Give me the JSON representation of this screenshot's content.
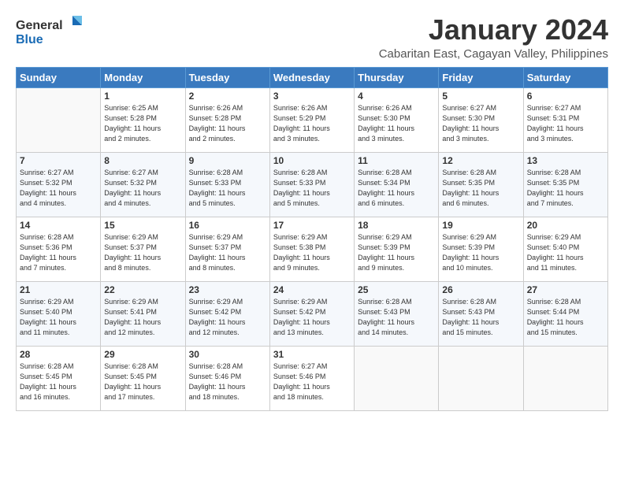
{
  "logo": {
    "general": "General",
    "blue": "Blue"
  },
  "title": {
    "month": "January 2024",
    "location": "Cabaritan East, Cagayan Valley, Philippines"
  },
  "weekdays": [
    "Sunday",
    "Monday",
    "Tuesday",
    "Wednesday",
    "Thursday",
    "Friday",
    "Saturday"
  ],
  "weeks": [
    [
      {
        "day": "",
        "info": ""
      },
      {
        "day": "1",
        "info": "Sunrise: 6:25 AM\nSunset: 5:28 PM\nDaylight: 11 hours\nand 2 minutes."
      },
      {
        "day": "2",
        "info": "Sunrise: 6:26 AM\nSunset: 5:28 PM\nDaylight: 11 hours\nand 2 minutes."
      },
      {
        "day": "3",
        "info": "Sunrise: 6:26 AM\nSunset: 5:29 PM\nDaylight: 11 hours\nand 3 minutes."
      },
      {
        "day": "4",
        "info": "Sunrise: 6:26 AM\nSunset: 5:30 PM\nDaylight: 11 hours\nand 3 minutes."
      },
      {
        "day": "5",
        "info": "Sunrise: 6:27 AM\nSunset: 5:30 PM\nDaylight: 11 hours\nand 3 minutes."
      },
      {
        "day": "6",
        "info": "Sunrise: 6:27 AM\nSunset: 5:31 PM\nDaylight: 11 hours\nand 3 minutes."
      }
    ],
    [
      {
        "day": "7",
        "info": "Sunrise: 6:27 AM\nSunset: 5:32 PM\nDaylight: 11 hours\nand 4 minutes."
      },
      {
        "day": "8",
        "info": "Sunrise: 6:27 AM\nSunset: 5:32 PM\nDaylight: 11 hours\nand 4 minutes."
      },
      {
        "day": "9",
        "info": "Sunrise: 6:28 AM\nSunset: 5:33 PM\nDaylight: 11 hours\nand 5 minutes."
      },
      {
        "day": "10",
        "info": "Sunrise: 6:28 AM\nSunset: 5:33 PM\nDaylight: 11 hours\nand 5 minutes."
      },
      {
        "day": "11",
        "info": "Sunrise: 6:28 AM\nSunset: 5:34 PM\nDaylight: 11 hours\nand 6 minutes."
      },
      {
        "day": "12",
        "info": "Sunrise: 6:28 AM\nSunset: 5:35 PM\nDaylight: 11 hours\nand 6 minutes."
      },
      {
        "day": "13",
        "info": "Sunrise: 6:28 AM\nSunset: 5:35 PM\nDaylight: 11 hours\nand 7 minutes."
      }
    ],
    [
      {
        "day": "14",
        "info": "Sunrise: 6:28 AM\nSunset: 5:36 PM\nDaylight: 11 hours\nand 7 minutes."
      },
      {
        "day": "15",
        "info": "Sunrise: 6:29 AM\nSunset: 5:37 PM\nDaylight: 11 hours\nand 8 minutes."
      },
      {
        "day": "16",
        "info": "Sunrise: 6:29 AM\nSunset: 5:37 PM\nDaylight: 11 hours\nand 8 minutes."
      },
      {
        "day": "17",
        "info": "Sunrise: 6:29 AM\nSunset: 5:38 PM\nDaylight: 11 hours\nand 9 minutes."
      },
      {
        "day": "18",
        "info": "Sunrise: 6:29 AM\nSunset: 5:39 PM\nDaylight: 11 hours\nand 9 minutes."
      },
      {
        "day": "19",
        "info": "Sunrise: 6:29 AM\nSunset: 5:39 PM\nDaylight: 11 hours\nand 10 minutes."
      },
      {
        "day": "20",
        "info": "Sunrise: 6:29 AM\nSunset: 5:40 PM\nDaylight: 11 hours\nand 11 minutes."
      }
    ],
    [
      {
        "day": "21",
        "info": "Sunrise: 6:29 AM\nSunset: 5:40 PM\nDaylight: 11 hours\nand 11 minutes."
      },
      {
        "day": "22",
        "info": "Sunrise: 6:29 AM\nSunset: 5:41 PM\nDaylight: 11 hours\nand 12 minutes."
      },
      {
        "day": "23",
        "info": "Sunrise: 6:29 AM\nSunset: 5:42 PM\nDaylight: 11 hours\nand 12 minutes."
      },
      {
        "day": "24",
        "info": "Sunrise: 6:29 AM\nSunset: 5:42 PM\nDaylight: 11 hours\nand 13 minutes."
      },
      {
        "day": "25",
        "info": "Sunrise: 6:28 AM\nSunset: 5:43 PM\nDaylight: 11 hours\nand 14 minutes."
      },
      {
        "day": "26",
        "info": "Sunrise: 6:28 AM\nSunset: 5:43 PM\nDaylight: 11 hours\nand 15 minutes."
      },
      {
        "day": "27",
        "info": "Sunrise: 6:28 AM\nSunset: 5:44 PM\nDaylight: 11 hours\nand 15 minutes."
      }
    ],
    [
      {
        "day": "28",
        "info": "Sunrise: 6:28 AM\nSunset: 5:45 PM\nDaylight: 11 hours\nand 16 minutes."
      },
      {
        "day": "29",
        "info": "Sunrise: 6:28 AM\nSunset: 5:45 PM\nDaylight: 11 hours\nand 17 minutes."
      },
      {
        "day": "30",
        "info": "Sunrise: 6:28 AM\nSunset: 5:46 PM\nDaylight: 11 hours\nand 18 minutes."
      },
      {
        "day": "31",
        "info": "Sunrise: 6:27 AM\nSunset: 5:46 PM\nDaylight: 11 hours\nand 18 minutes."
      },
      {
        "day": "",
        "info": ""
      },
      {
        "day": "",
        "info": ""
      },
      {
        "day": "",
        "info": ""
      }
    ]
  ]
}
